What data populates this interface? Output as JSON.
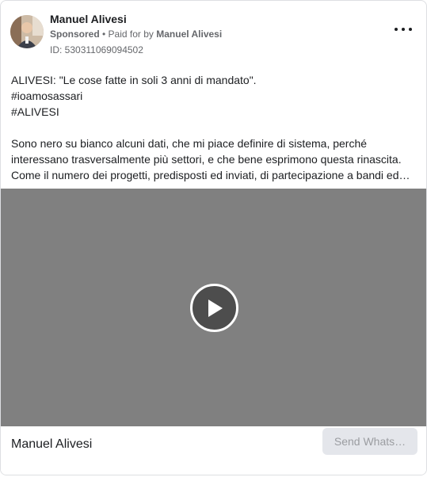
{
  "post": {
    "author": "Manuel Alivesi",
    "sponsored": "Sponsored",
    "separator": " • ",
    "paid_for_prefix": "Paid for by",
    "paid_for_name": "Manuel Alivesi",
    "ad_id": "ID: 530311069094502",
    "more_icon": "more-horizontal-icon",
    "text_lines": [
      "ALIVESI: \"Le cose fatte in soli 3 anni di mandato\".",
      "#ioamosassari",
      "#ALIVESI"
    ],
    "body_lines": [
      "Sono nero su bianco alcuni dati, che mi piace definire di sistema, perché",
      "interessano trasversalmente più settori, e che bene esprimono questa rinascita.",
      "Come il numero dei progetti, predisposti ed inviati, di partecipazione a bandi ed…"
    ]
  },
  "video": {
    "background_color": "#808080",
    "play_icon": "play-icon"
  },
  "footer": {
    "page_name": "Manuel Alivesi",
    "cta_label": "Send Whats…"
  }
}
